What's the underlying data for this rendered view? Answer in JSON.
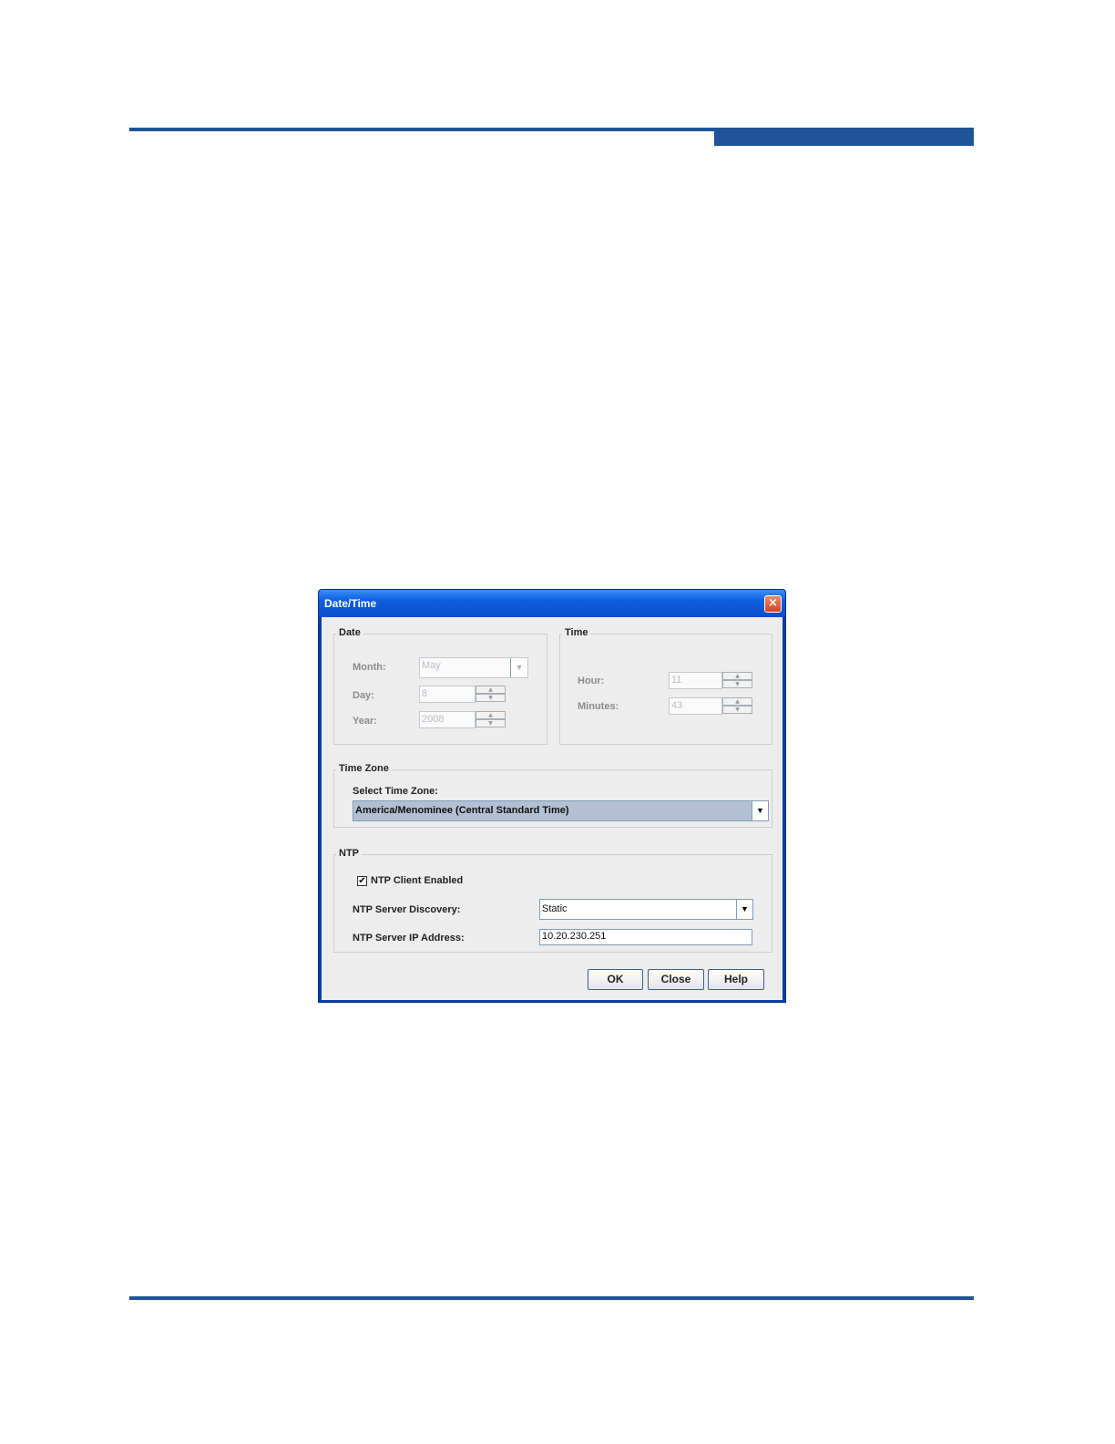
{
  "dialog": {
    "title": "Date/Time",
    "close_icon": "×"
  },
  "date_group": {
    "legend": "Date",
    "month_label": "Month:",
    "month_value": "May",
    "day_label": "Day:",
    "day_value": "8",
    "year_label": "Year:",
    "year_value": "2008"
  },
  "time_group": {
    "legend": "Time",
    "hour_label": "Hour:",
    "hour_value": "11",
    "minutes_label": "Minutes:",
    "minutes_value": "43"
  },
  "timezone_group": {
    "legend": "Time Zone",
    "select_label": "Select Time Zone:",
    "select_value": "America/Menominee (Central Standard Time)"
  },
  "ntp_group": {
    "legend": "NTP",
    "client_enabled_label": "NTP Client Enabled",
    "client_enabled": true,
    "check_glyph": "✔",
    "discovery_label": "NTP Server Discovery:",
    "discovery_value": "Static",
    "ip_label": "NTP Server IP Address:",
    "ip_value": "10.20.230.251"
  },
  "buttons": {
    "ok": "OK",
    "close": "Close",
    "help": "Help"
  },
  "icons": {
    "dropdown_arrow": "▼",
    "spin_up": "▲",
    "spin_down": "▼"
  }
}
